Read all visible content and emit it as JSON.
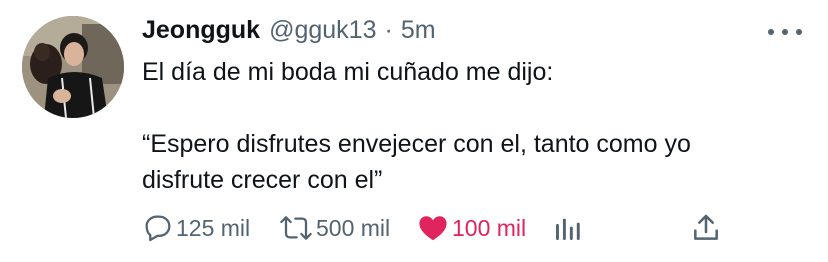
{
  "tweet": {
    "author_name": "Jeongguk",
    "handle": "@gguk13",
    "separator": "·",
    "time": "5m",
    "text_line1": "El día de mi boda mi cuñado me dijo:",
    "text_line2": "“Espero disfrutes envejecer con el, tanto como yo",
    "text_line3": "disfrute crecer con el”"
  },
  "actions": {
    "replies": "125 mil",
    "retweets": "500 mil",
    "likes": "100 mil",
    "liked": true
  },
  "colors": {
    "text": "#0f1419",
    "secondary": "#536471",
    "like": "#e0245e"
  },
  "icons": [
    "more-icon",
    "reply-icon",
    "retweet-icon",
    "heart-icon",
    "analytics-icon",
    "share-icon"
  ]
}
